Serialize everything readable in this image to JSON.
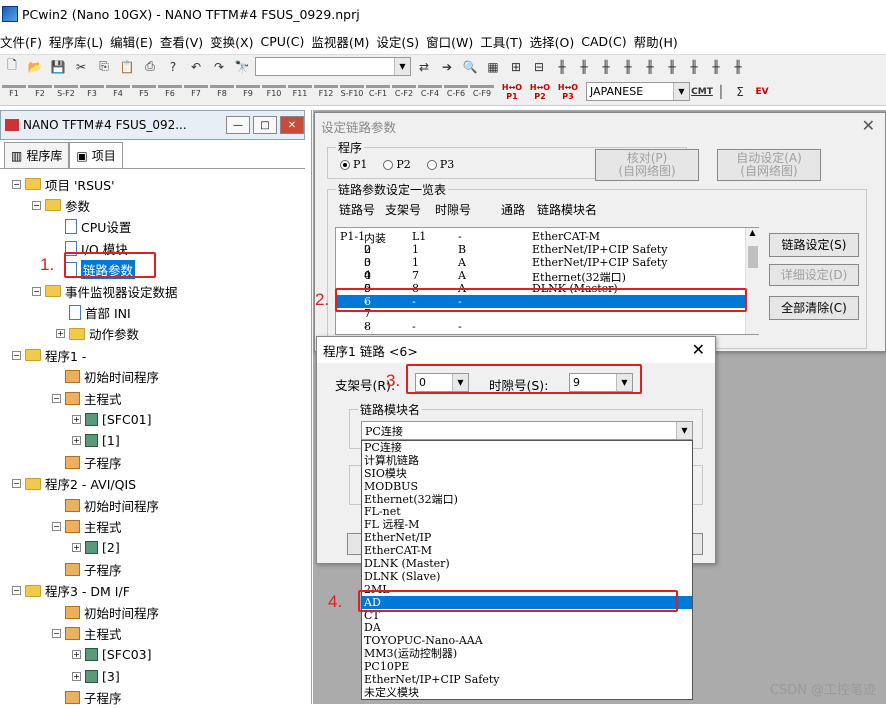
{
  "app_title": "PCwin2 (Nano 10GX) - NANO TFTM#4 FSUS_0929.nprj",
  "menu": [
    "文件(F)",
    "程序库(L)",
    "编辑(E)",
    "查看(V)",
    "变换(X)",
    "CPU(C)",
    "监视器(M)",
    "设定(S)",
    "窗口(W)",
    "工具(T)",
    "选择(O)",
    "CAD(C)",
    "帮助(H)"
  ],
  "toolbar": {
    "language": "JAPANESE",
    "cmt": "CMT",
    "ev": "EV",
    "fkeys": [
      "F1",
      "F2",
      "S-F2",
      "F3",
      "F4",
      "F5",
      "F6",
      "F7",
      "F8",
      "F9",
      "F10",
      "F11",
      "F12",
      "S-F10",
      "C-F1",
      "C-F2",
      "C-F4",
      "C-F6",
      "C-F9"
    ],
    "hio": [
      "P1",
      "P2",
      "P3"
    ]
  },
  "left_window": {
    "title": "NANO TFTM#4 FSUS_092...",
    "tabs": [
      "程序库",
      "项目"
    ],
    "tree": [
      {
        "label": "项目 'RSUS'"
      },
      {
        "label": "参数"
      },
      {
        "label": "CPU设置"
      },
      {
        "label": "I/O 模块"
      },
      {
        "label": "链路参数"
      },
      {
        "label": "事件监视器设定数据"
      },
      {
        "label": "首部 INI"
      },
      {
        "label": "动作参数"
      },
      {
        "label": "程序1 -"
      },
      {
        "label": "初始时间程序"
      },
      {
        "label": "主程式"
      },
      {
        "label": "[SFC01]"
      },
      {
        "label": "[1]"
      },
      {
        "label": "子程序"
      },
      {
        "label": "程序2 - AVI/QIS"
      },
      {
        "label": "初始时间程序"
      },
      {
        "label": "主程式"
      },
      {
        "label": "[2]"
      },
      {
        "label": "子程序"
      },
      {
        "label": "程序3 - DM I/F"
      },
      {
        "label": "初始时间程序"
      },
      {
        "label": "主程式"
      },
      {
        "label": "[SFC03]"
      },
      {
        "label": "[3]"
      },
      {
        "label": "子程序"
      }
    ]
  },
  "link_dialog": {
    "title": "设定链路参数",
    "program_group": "程序",
    "programs": [
      "P1",
      "P2",
      "P3"
    ],
    "btn_check": "核对(P)\n(自网络图)",
    "btn_auto": "自动设定(A)\n(自网络图)",
    "list_group": "链路参数设定一览表",
    "headers": [
      "链路号",
      "支架号",
      "时隙号",
      "通路",
      "链路模块名"
    ],
    "rows": [
      [
        "P1-1",
        "内装",
        "L1",
        "-",
        "EtherCAT-M"
      ],
      [
        "2",
        "0",
        "1",
        "B",
        "EtherNet/IP+CIP Safety"
      ],
      [
        "3",
        "0",
        "1",
        "A",
        "EtherNet/IP+CIP Safety"
      ],
      [
        "4",
        "0",
        "7",
        "A",
        "Ethernet(32端口)"
      ],
      [
        "5",
        "0",
        "8",
        "A",
        "DLNK (Master)"
      ],
      [
        "6",
        "-",
        "-",
        "-",
        ""
      ],
      [
        "7",
        "",
        "",
        "",
        ""
      ],
      [
        "8",
        "-",
        "-",
        "-",
        ""
      ]
    ],
    "btn_link": "链路设定(S)",
    "btn_detail": "详细设定(D)",
    "btn_clear": "全部清除(C)"
  },
  "link6_dialog": {
    "title": "程序1  链路 <6>",
    "rack_label": "支架号(R):",
    "rack_value": "0",
    "slot_label": "时隙号(S):",
    "slot_value": "9",
    "module_group": "链路模块名",
    "module_value": "PC连接",
    "options": [
      "PC连接",
      "计算机链路",
      "SIO模块",
      "MODBUS",
      "Ethernet(32端口)",
      "FL-net",
      "FL 远程-M",
      "EtherNet/IP",
      "EtherCAT-M",
      "DLNK (Master)",
      "DLNK (Slave)",
      "2ML",
      "AD",
      "CT",
      "DA",
      "TOYOPUC-Nano-AAA",
      "MM3(运动控制器)",
      "PC10PE",
      "EtherNet/IP+CIP Safety",
      "未定义模块"
    ],
    "selected_option": "AD"
  },
  "annotations": [
    "1.",
    "2.",
    "3.",
    "4."
  ],
  "watermark": "CSDN @工控笔迹"
}
